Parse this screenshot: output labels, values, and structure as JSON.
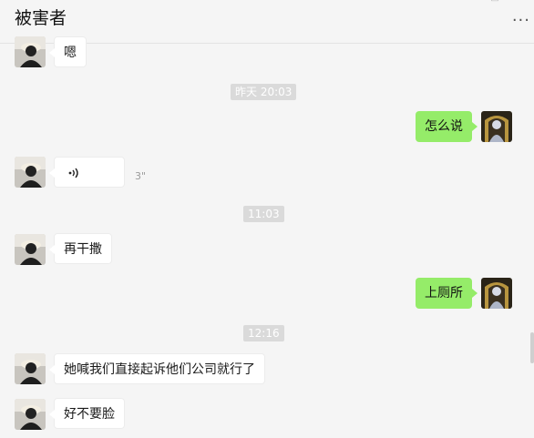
{
  "header": {
    "title": "被害者",
    "more_label": "···"
  },
  "messages": [
    {
      "id": "m1",
      "side": "in",
      "text": "嗯"
    },
    {
      "id": "t1",
      "type": "timestamp",
      "text": "昨天 20:03"
    },
    {
      "id": "m2",
      "side": "out",
      "text": "怎么说"
    },
    {
      "id": "m3",
      "side": "in",
      "type": "voice",
      "icon": "voice-wave-icon",
      "duration": "3\""
    },
    {
      "id": "t2",
      "type": "timestamp",
      "text": "11:03"
    },
    {
      "id": "m4",
      "side": "in",
      "text": "再干撒"
    },
    {
      "id": "m5",
      "side": "out",
      "text": "上厕所"
    },
    {
      "id": "t3",
      "type": "timestamp",
      "text": "12:16"
    },
    {
      "id": "m6",
      "side": "in",
      "text": "她喊我们直接起诉他们公司就行了"
    },
    {
      "id": "m7",
      "side": "in",
      "text": "好不要脸"
    }
  ],
  "colors": {
    "background": "#f5f5f5",
    "outgoing_bubble": "#95ec69",
    "incoming_bubble": "#ffffff",
    "timestamp_bg": "#dadada"
  }
}
